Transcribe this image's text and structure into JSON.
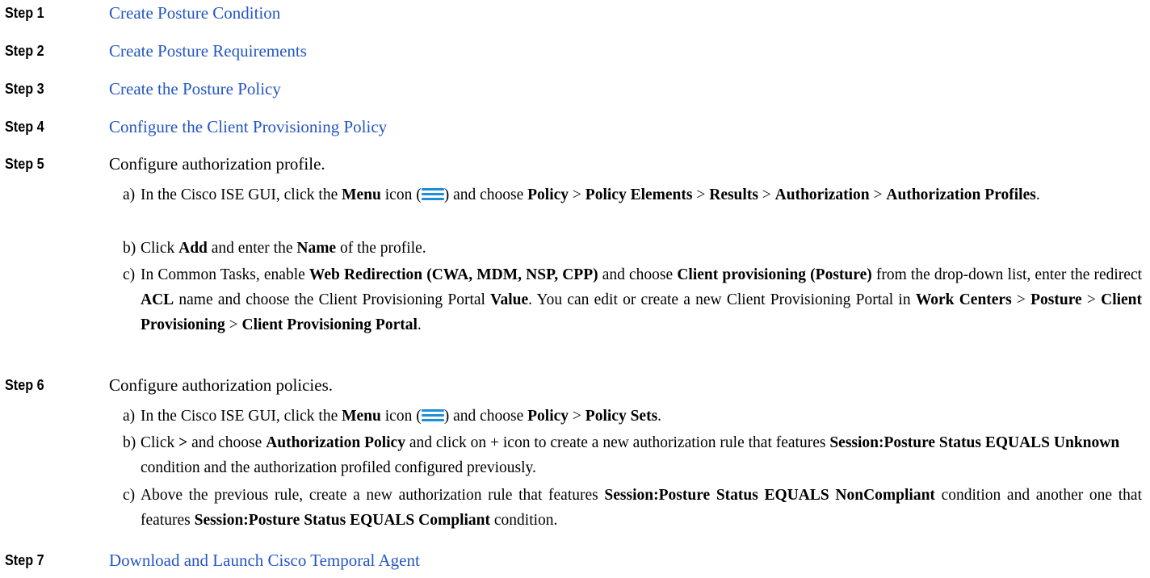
{
  "steps": [
    {
      "label": "Step 1",
      "text": "Create Posture Condition"
    },
    {
      "label": "Step 2",
      "text": "Create Posture Requirements"
    },
    {
      "label": "Step 3",
      "text": "Create the Posture Policy"
    },
    {
      "label": "Step 4",
      "text": "Configure the Client Provisioning Policy"
    },
    {
      "label": "Step 5",
      "text": "Configure authorization profile."
    },
    {
      "label": "Step 6",
      "text": "Configure authorization policies."
    },
    {
      "label": "Step 7",
      "text": "Download and Launch Cisco Temporal Agent"
    }
  ],
  "step5_subs": {
    "a": {
      "letter": "a)",
      "t1": "In the Cisco ISE GUI, click the ",
      "b1": "Menu",
      "t2": " icon (",
      "t3": ") and choose ",
      "b2": "Policy",
      "t4": " > ",
      "b3": "Policy Elements",
      "t5": " > ",
      "b4": "Results",
      "t6": " > ",
      "b5": "Authorization",
      "t7": " > ",
      "b6": "Authorization Profiles",
      "t8": "."
    },
    "b": {
      "letter": "b)",
      "t1": "Click ",
      "b1": "Add",
      "t2": " and enter the ",
      "b2": "Name",
      "t3": " of the profile."
    },
    "c": {
      "letter": "c)",
      "t1": "In Common Tasks, enable ",
      "b1": "Web Redirection (CWA, MDM, NSP, CPP)",
      "t2": " and choose ",
      "b2": "Client provisioning (Posture)",
      "t3": " from the drop-down list, enter the redirect ",
      "b3": "ACL",
      "t4": " name and choose the Client Provisioning Portal ",
      "b4": "Value",
      "t5": ". You can edit or create a new Client Provisioning Portal in ",
      "b5": "Work Centers",
      "t6": " > ",
      "b6": "Posture",
      "t7": " > ",
      "b7": "Client Provisioning",
      "t8": " > ",
      "b8": "Client Provisioning Portal",
      "t9": "."
    }
  },
  "step6_subs": {
    "a": {
      "letter": "a)",
      "t1": "In the Cisco ISE GUI, click the ",
      "b1": "Menu",
      "t2": " icon (",
      "t3": ") and choose ",
      "b2": "Policy",
      "t4": " > ",
      "b3": "Policy Sets",
      "t5": "."
    },
    "b": {
      "letter": "b)",
      "t1": "Click ",
      "b1": ">",
      "t2": " and choose ",
      "b2": "Authorization Policy",
      "t3": " and click on + icon to create a new authorization rule that features ",
      "b3": "Session:Posture Status EQUALS Unknown",
      "t4": " condition and the authorization profiled configured previously."
    },
    "c": {
      "letter": "c)",
      "t1": "Above the previous rule, create a new authorization rule that features ",
      "b1": "Session:Posture Status EQUALS NonCompliant",
      "t2": " condition and another one that features ",
      "b2": "Session:Posture Status EQUALS Compliant",
      "t3": " condition."
    }
  },
  "colors": {
    "link": "#2456c4",
    "menu_icon": "#1e8fd6",
    "text": "#000000"
  },
  "icons": {
    "menu": "hamburger-menu-icon"
  }
}
